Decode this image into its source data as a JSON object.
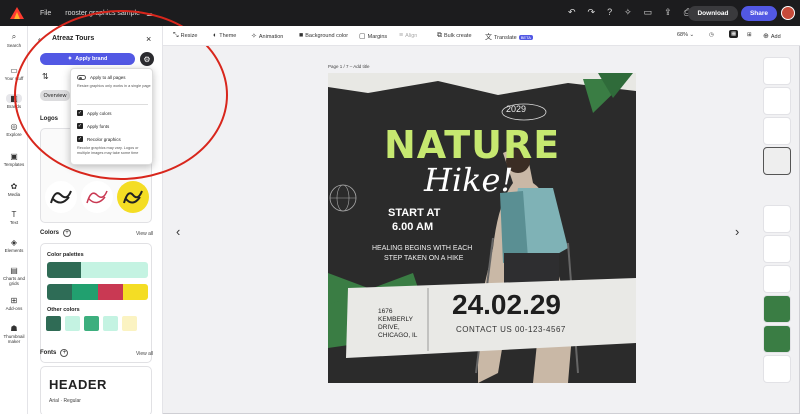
{
  "topbar": {
    "file": "File",
    "title": "rooster graphics sample",
    "download": "Download",
    "share": "Share"
  },
  "rail": [
    {
      "label": "Search",
      "icon": "search-icon"
    },
    {
      "label": "Your stuff",
      "icon": "folder-icon"
    },
    {
      "label": "Brands",
      "icon": "brand-icon"
    },
    {
      "label": "Explore",
      "icon": "explore-icon"
    },
    {
      "label": "Templates",
      "icon": "templates-icon"
    },
    {
      "label": "Media",
      "icon": "media-icon"
    },
    {
      "label": "Text",
      "icon": "text-icon"
    },
    {
      "label": "Elements",
      "icon": "elements-icon"
    },
    {
      "label": "Charts and grids",
      "icon": "charts-icon"
    },
    {
      "label": "Add-ons",
      "icon": "addons-icon"
    },
    {
      "label": "Thumbnail maker",
      "icon": "thumbnail-icon"
    }
  ],
  "panel": {
    "title": "Atreaz Tours",
    "apply_brand": "Apply brand",
    "overview": "Overview",
    "logos": "Logos",
    "colors": "Colors",
    "view_all": "View all",
    "color_palettes": "Color palettes",
    "other_colors": "Other colors",
    "fonts": "Fonts",
    "header_sample": "HEADER",
    "header_font": "Arial · Regular"
  },
  "dropdown": {
    "apply_all_pages": "Apply to all pages",
    "apply_all_note": "Resize graphics only works in a single page",
    "apply_colors": "Apply colors",
    "apply_fonts": "Apply fonts",
    "recolor_graphics": "Recolor graphics",
    "recolor_note": "Recolor graphics may vary. Logos or multiple images may take some time"
  },
  "editor_toolbar": {
    "resize": "Resize",
    "theme": "Theme",
    "animation": "Animation",
    "background": "Background color",
    "margins": "Margins",
    "align": "Align",
    "bulk_create": "Bulk create",
    "translate": "Translate",
    "beta": "BETA",
    "zoom": "68%",
    "add": "Add"
  },
  "canvas": {
    "page_label": "Page 1 / 7 – Add title"
  },
  "poster": {
    "year": "2029",
    "nature": "NATURE",
    "hike": "Hike!",
    "start_at": "START AT",
    "time": "6.00 AM",
    "tagline1": "HEALING BEGINS WITH EACH",
    "tagline2": "STEP TAKEN ON A HIKE",
    "address1": "1676",
    "address2": "KEMBERLY",
    "address3": "DRIVE,",
    "address4": "CHICAGO, IL",
    "date": "24.02.29",
    "contact": "CONTACT US 00-123-4567"
  },
  "colors": {
    "brand_blue": "#5258e4",
    "palette1": [
      "#2f6b55",
      "#c4f3e2"
    ],
    "palette2": [
      "#2e6c56",
      "#21a06f",
      "#c93953",
      "#f4dd24"
    ],
    "other": [
      "#2f6b55",
      "#c4f3e2",
      "#3daf7e",
      "#c4f3e2",
      "#fbf3c2"
    ],
    "poster_green": "#c6e870",
    "annotation_red": "#d8261c"
  }
}
